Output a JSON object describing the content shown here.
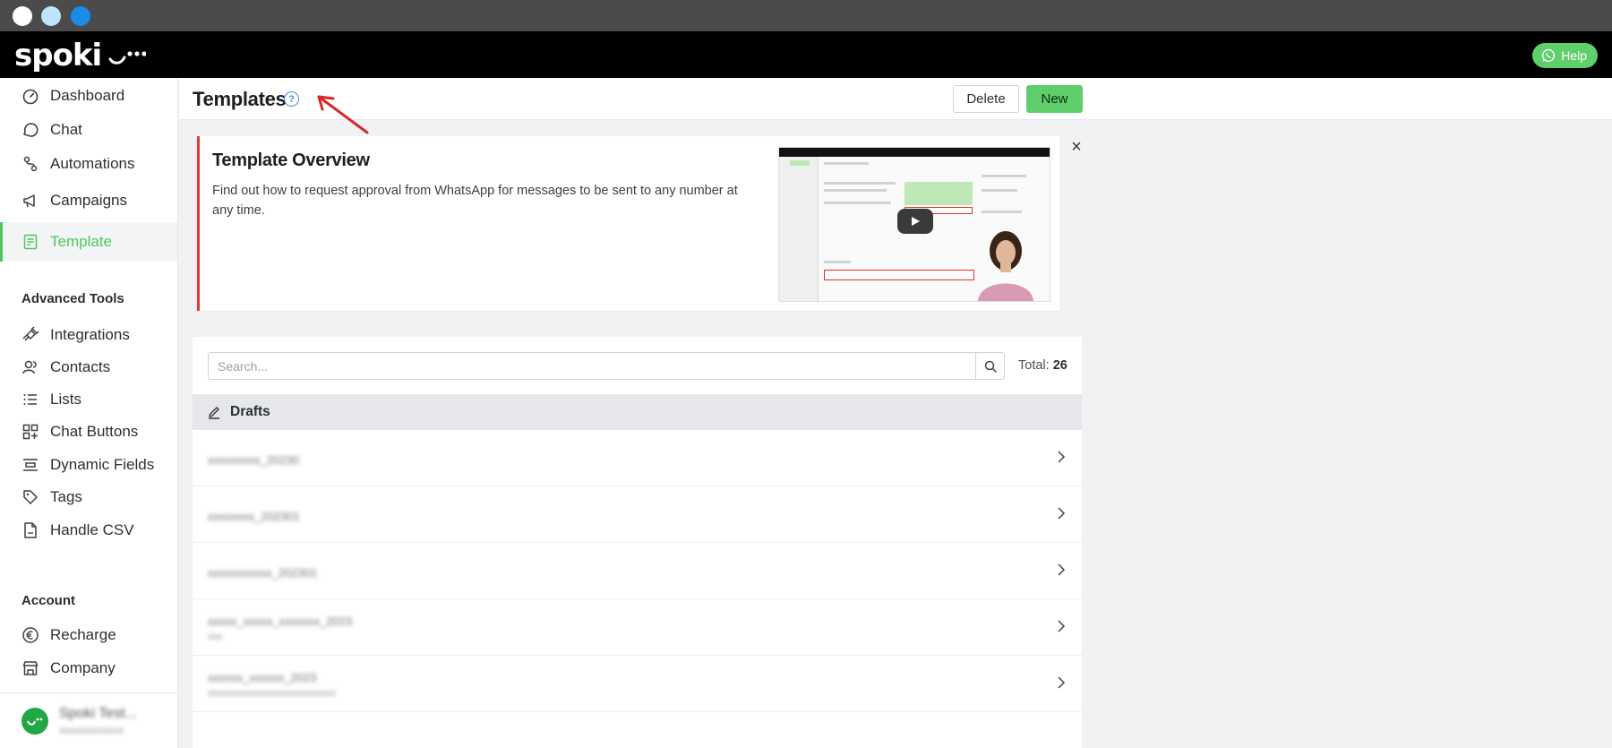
{
  "app": {
    "logo_text": "spoki"
  },
  "header": {
    "help_label": "Help"
  },
  "sidebar": {
    "main_items": [
      {
        "label": "Dashboard",
        "icon": "dashboard-icon"
      },
      {
        "label": "Chat",
        "icon": "chat-icon"
      },
      {
        "label": "Automations",
        "icon": "automations-icon"
      },
      {
        "label": "Campaigns",
        "icon": "megaphone-icon"
      },
      {
        "label": "Template",
        "icon": "template-icon",
        "active": true
      }
    ],
    "advanced_title": "Advanced Tools",
    "advanced_items": [
      {
        "label": "Integrations",
        "icon": "plug-icon"
      },
      {
        "label": "Contacts",
        "icon": "contacts-icon"
      },
      {
        "label": "Lists",
        "icon": "list-icon"
      },
      {
        "label": "Chat Buttons",
        "icon": "grid-icon"
      },
      {
        "label": "Dynamic Fields",
        "icon": "fields-icon"
      },
      {
        "label": "Tags",
        "icon": "tag-icon"
      },
      {
        "label": "Handle CSV",
        "icon": "csv-file-icon"
      }
    ],
    "account_title": "Account",
    "account_items": [
      {
        "label": "Recharge",
        "icon": "euro-icon"
      },
      {
        "label": "Company",
        "icon": "store-icon"
      }
    ],
    "user": {
      "name": "Spoki Test...",
      "sub": "xxxxxxxxxxxx"
    }
  },
  "page": {
    "title": "Templates",
    "help_glyph": "?",
    "delete_label": "Delete",
    "new_label": "New"
  },
  "overview": {
    "title": "Template Overview",
    "description": "Find out how to request approval from WhatsApp for messages to be sent to any number at any time.",
    "close_glyph": "×"
  },
  "list": {
    "search_placeholder": "Search...",
    "total_label": "Total:",
    "total_value": "26",
    "section_label": "Drafts",
    "rows": [
      {
        "line1": "xxxxxxxxx_20230",
        "line2": ""
      },
      {
        "line1": "xxxxxxxx_202301",
        "line2": ""
      },
      {
        "line1": "xxxxxxxxxxx_202301",
        "line2": ""
      },
      {
        "line1": "xxxxx_xxxxx_xxxxxxx_2023",
        "line2": "xxx"
      },
      {
        "line1": "xxxxxx_xxxxxx_2023",
        "line2": "xxxxxxxxxxxxxxxxxxxxxxxxxx"
      }
    ]
  },
  "colors": {
    "accent": "#5fcf6b",
    "alert": "#e23a3a",
    "link": "#3d8fe0"
  }
}
